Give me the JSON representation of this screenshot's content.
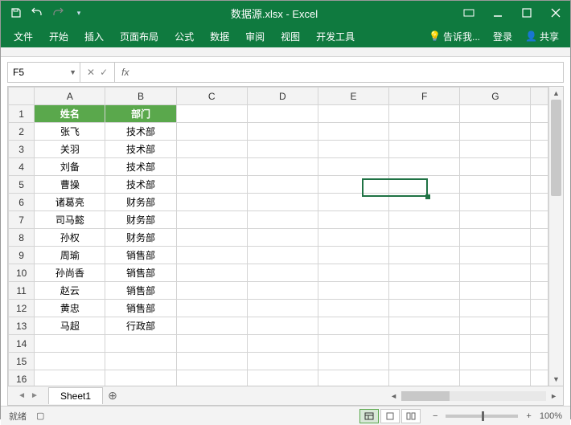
{
  "title": "数据源.xlsx - Excel",
  "qat": {
    "save": "save",
    "undo": "undo",
    "redo": "redo"
  },
  "ribbon": {
    "tabs": [
      "文件",
      "开始",
      "插入",
      "页面布局",
      "公式",
      "数据",
      "审阅",
      "视图",
      "开发工具"
    ],
    "tell_me": "告诉我...",
    "signin": "登录",
    "share": "共享"
  },
  "namebox": {
    "value": "F5"
  },
  "fx": {
    "label": "fx",
    "cancel": "✕",
    "confirm": "✓"
  },
  "formula": "",
  "columns": [
    "A",
    "B",
    "C",
    "D",
    "E",
    "F",
    "G"
  ],
  "headers": {
    "A": "姓名",
    "B": "部门"
  },
  "rows": [
    {
      "n": 1,
      "A": "姓名",
      "B": "部门",
      "hdr": true
    },
    {
      "n": 2,
      "A": "张飞",
      "B": "技术部"
    },
    {
      "n": 3,
      "A": "关羽",
      "B": "技术部"
    },
    {
      "n": 4,
      "A": "刘备",
      "B": "技术部"
    },
    {
      "n": 5,
      "A": "曹操",
      "B": "技术部"
    },
    {
      "n": 6,
      "A": "诸葛亮",
      "B": "财务部"
    },
    {
      "n": 7,
      "A": "司马懿",
      "B": "财务部"
    },
    {
      "n": 8,
      "A": "孙权",
      "B": "财务部"
    },
    {
      "n": 9,
      "A": "周瑜",
      "B": "销售部"
    },
    {
      "n": 10,
      "A": "孙尚香",
      "B": "销售部"
    },
    {
      "n": 11,
      "A": "赵云",
      "B": "销售部"
    },
    {
      "n": 12,
      "A": "黄忠",
      "B": "销售部"
    },
    {
      "n": 13,
      "A": "马超",
      "B": "行政部"
    }
  ],
  "selected": {
    "col": "F",
    "row": 5
  },
  "sheet_tab": "Sheet1",
  "status": {
    "ready": "就绪",
    "record": "",
    "zoom": "100%"
  }
}
